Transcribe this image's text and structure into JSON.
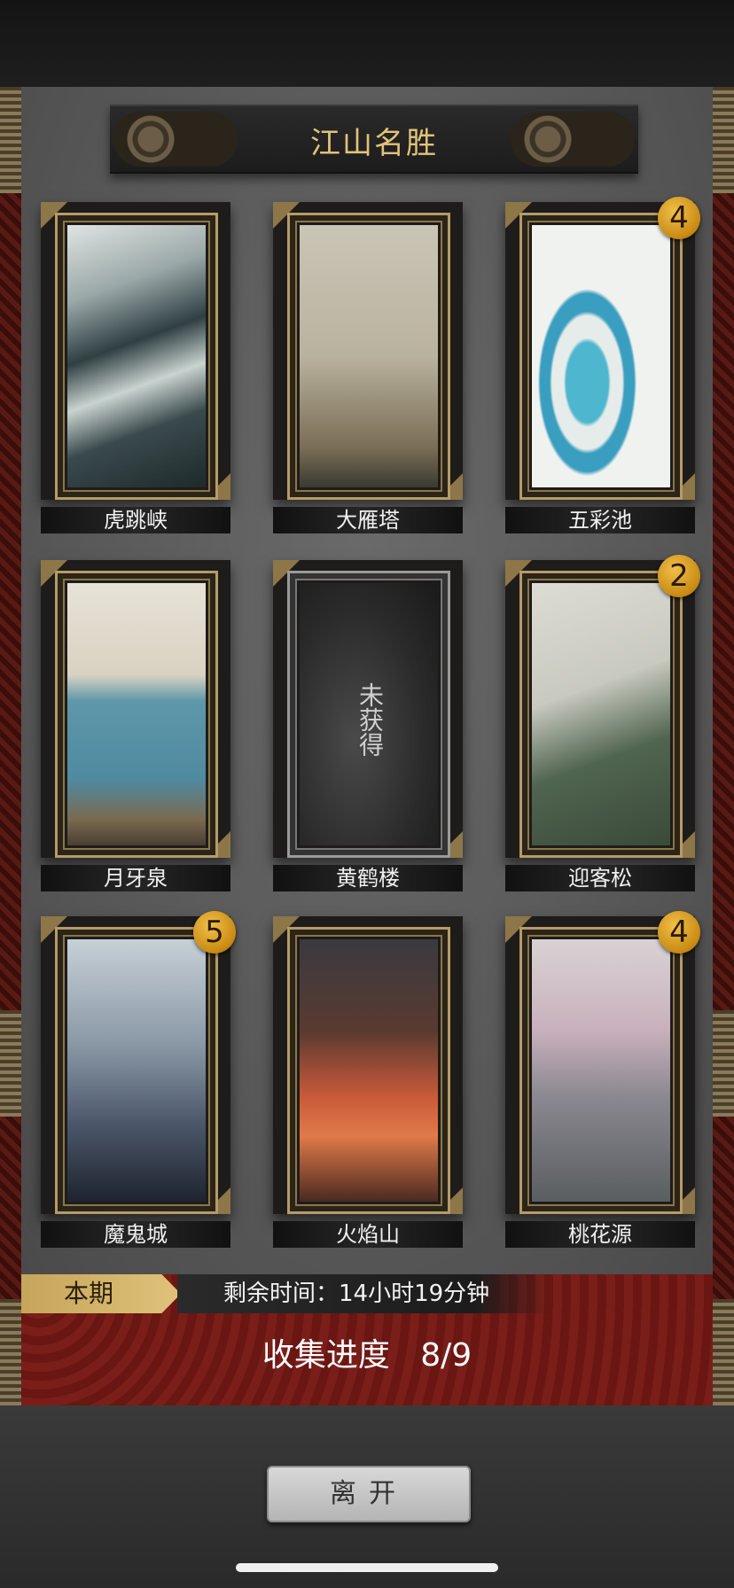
{
  "header": {
    "title": "江山名胜"
  },
  "cards": [
    {
      "name": "虎跳峡",
      "badge": "",
      "locked": false,
      "art": "waves"
    },
    {
      "name": "大雁塔",
      "badge": "",
      "locked": false,
      "art": "pagoda"
    },
    {
      "name": "五彩池",
      "badge": "4",
      "locked": false,
      "art": "pools"
    },
    {
      "name": "月牙泉",
      "badge": "",
      "locked": false,
      "art": "desert"
    },
    {
      "name": "黄鹤楼",
      "badge": "",
      "locked": true,
      "locked_text": "未获得",
      "art": "locked"
    },
    {
      "name": "迎客松",
      "badge": "2",
      "locked": false,
      "art": "pine"
    },
    {
      "name": "魔鬼城",
      "badge": "5",
      "locked": false,
      "art": "castle"
    },
    {
      "name": "火焰山",
      "badge": "",
      "locked": false,
      "art": "fire"
    },
    {
      "name": "桃花源",
      "badge": "4",
      "locked": false,
      "art": "blossom"
    }
  ],
  "period": {
    "tag": "本期",
    "time_remaining": "剩余时间：14小时19分钟"
  },
  "progress": {
    "label": "收集进度",
    "value": "8/9"
  },
  "buttons": {
    "leave": "离开"
  },
  "colors": {
    "gold": "#e2c27a",
    "badge": "#d9a020",
    "footer_red": "#7a1e1a"
  }
}
